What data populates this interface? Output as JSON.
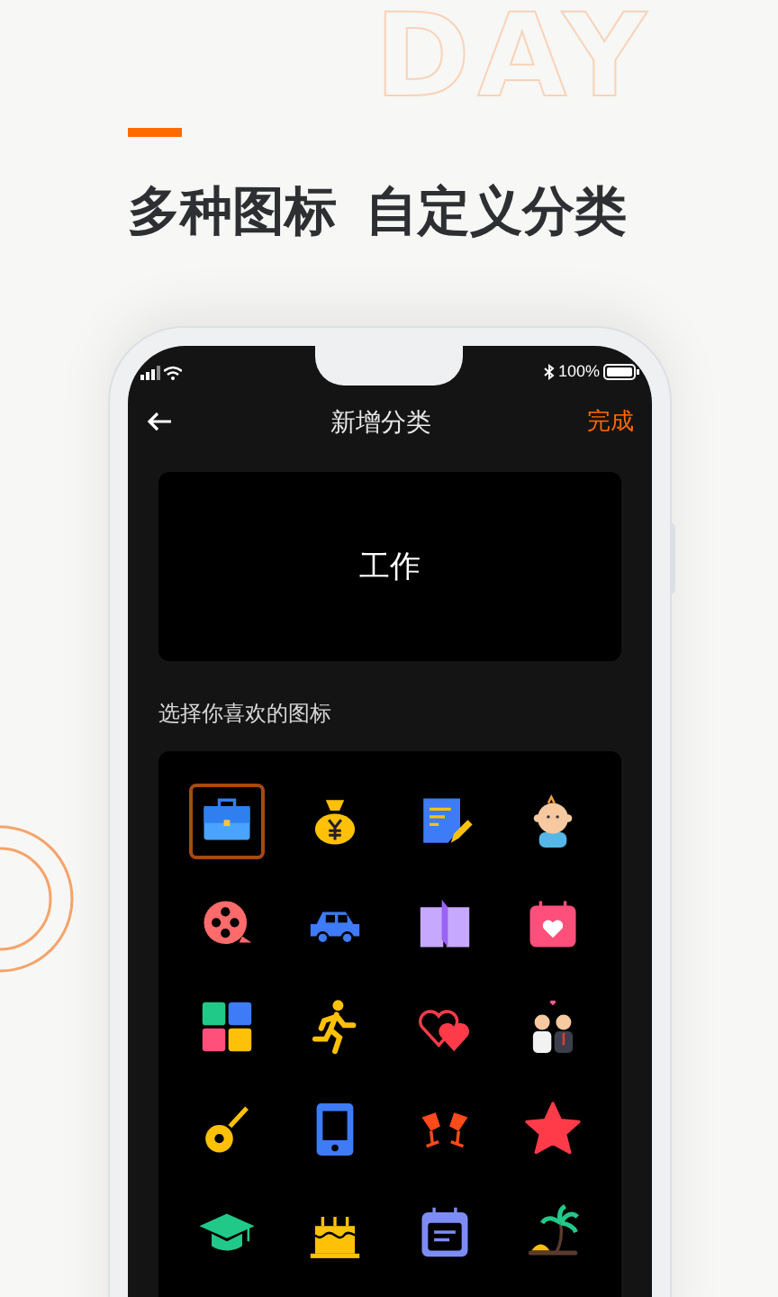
{
  "backdrop_text": "DAY",
  "heading": "多种图标  自定义分类",
  "status_bar": {
    "battery": "100%"
  },
  "nav": {
    "title": "新增分类",
    "action": "完成"
  },
  "name_card": {
    "value": "工作"
  },
  "icon_section": {
    "label": "选择你喜欢的图标",
    "icons": [
      {
        "selected": true
      },
      {
        "selected": false
      },
      {
        "selected": false
      },
      {
        "selected": false
      },
      {
        "selected": false
      },
      {
        "selected": false
      },
      {
        "selected": false
      },
      {
        "selected": false
      },
      {
        "selected": false
      },
      {
        "selected": false
      },
      {
        "selected": false
      },
      {
        "selected": false
      },
      {
        "selected": false
      },
      {
        "selected": false
      },
      {
        "selected": false
      },
      {
        "selected": false
      },
      {
        "selected": false
      },
      {
        "selected": false
      },
      {
        "selected": false
      },
      {
        "selected": false
      }
    ]
  }
}
